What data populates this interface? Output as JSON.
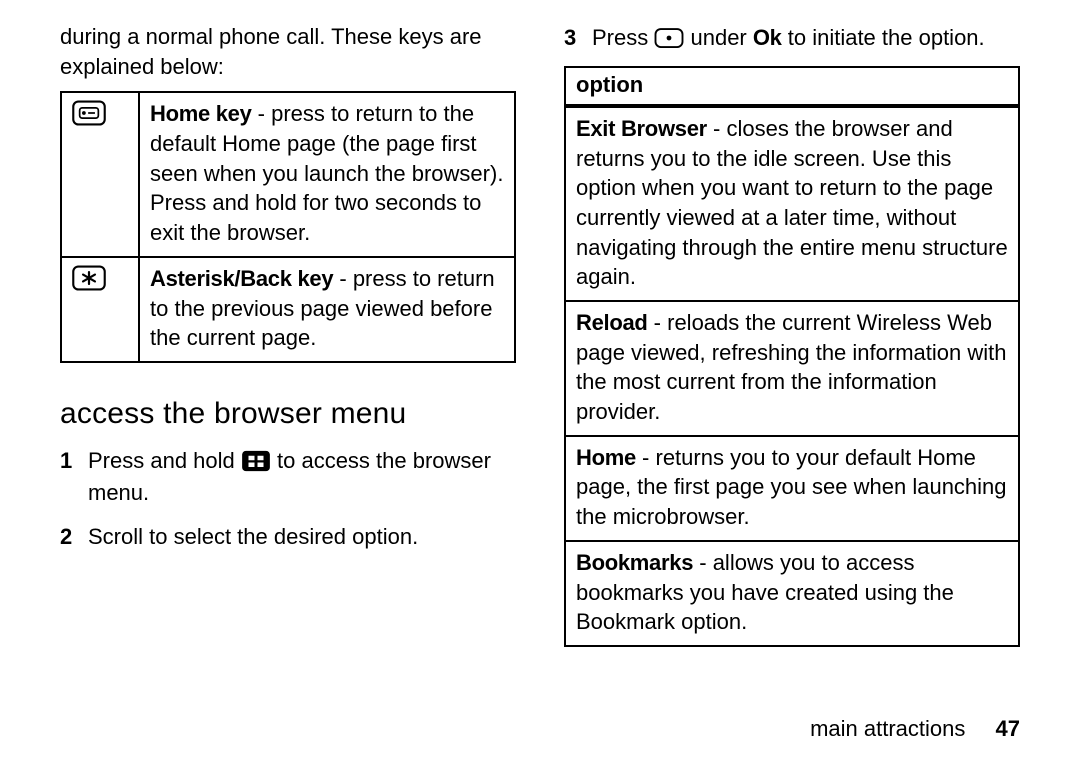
{
  "left": {
    "intro": "during a normal phone call. These keys are explained below:",
    "keys": [
      {
        "label": "Home key",
        "desc": " - press to return to the default Home page (the page first seen when you launch the browser). Press and hold for two seconds to exit the browser."
      },
      {
        "label": "Asterisk/Back key",
        "desc": " - press to return to the previous page viewed before the current page."
      }
    ],
    "section_title": "access the browser menu",
    "steps": [
      {
        "n": "1",
        "pre": "Press and hold ",
        "post": " to access the browser menu."
      },
      {
        "n": "2",
        "text": "Scroll to select the desired option."
      }
    ]
  },
  "right": {
    "step3": {
      "n": "3",
      "pre": "Press ",
      "mid": " under ",
      "ok": "Ok",
      "post": " to initiate the option."
    },
    "option_header": "option",
    "options": [
      {
        "label": "Exit Browser",
        "desc": " - closes the browser and returns you to the idle screen. Use this option when you want to return to the page currently viewed at a later time, without navigating through the entire menu structure again."
      },
      {
        "label": "Reload",
        "desc": " - reloads the current Wireless Web page viewed, refreshing the information with the most current from the information provider."
      },
      {
        "label": "Home",
        "desc": " - returns you to your default Home page, the first page you see when launching the microbrowser."
      },
      {
        "label": "Bookmarks",
        "desc": " - allows you to access bookmarks you have created using the Bookmark option."
      }
    ]
  },
  "footer": {
    "section": "main attractions",
    "page": "47"
  }
}
